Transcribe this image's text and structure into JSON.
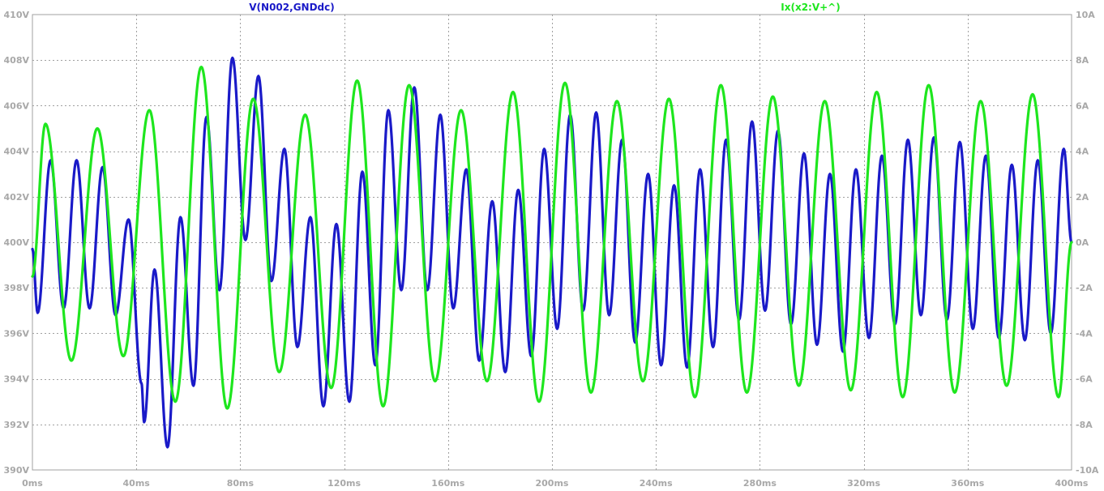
{
  "chart_data": {
    "type": "line",
    "title": "",
    "background": "#ffffff",
    "grid": true,
    "grid_color": "#a0a0a0",
    "x_axis": {
      "range": [
        0,
        400
      ],
      "unit": "ms",
      "ticks": [
        "0ms",
        "40ms",
        "80ms",
        "120ms",
        "160ms",
        "200ms",
        "240ms",
        "280ms",
        "320ms",
        "360ms",
        "400ms"
      ],
      "tick_values": [
        0,
        40,
        80,
        120,
        160,
        200,
        240,
        280,
        320,
        360,
        400
      ]
    },
    "y_left": {
      "range": [
        390,
        410
      ],
      "unit": "V",
      "ticks": [
        "390V",
        "392V",
        "394V",
        "396V",
        "398V",
        "400V",
        "402V",
        "404V",
        "406V",
        "408V",
        "410V"
      ],
      "tick_values": [
        390,
        392,
        394,
        396,
        398,
        400,
        402,
        404,
        406,
        408,
        410
      ]
    },
    "y_right": {
      "range": [
        -10,
        10
      ],
      "unit": "A",
      "ticks": [
        "-10A",
        "-8A",
        "-6A",
        "-4A",
        "-2A",
        "0A",
        "2A",
        "4A",
        "6A",
        "8A",
        "10A"
      ],
      "tick_values": [
        -10,
        -8,
        -6,
        -4,
        -2,
        0,
        2,
        4,
        6,
        8,
        10
      ]
    },
    "series": [
      {
        "name": "V(N002,GNDdc)",
        "axis": "left",
        "color": "#1a1ac8",
        "freq_hz": 100,
        "points": [
          [
            0,
            399.7
          ],
          [
            2,
            396.9
          ],
          [
            7,
            403.6
          ],
          [
            12,
            397.1
          ],
          [
            17,
            403.6
          ],
          [
            22,
            397.1
          ],
          [
            27,
            403.3
          ],
          [
            32,
            396.8
          ],
          [
            37,
            401.0
          ],
          [
            42,
            393.8
          ],
          [
            43,
            392.1
          ],
          [
            47,
            398.8
          ],
          [
            52,
            391.0
          ],
          [
            57,
            401.1
          ],
          [
            62,
            393.7
          ],
          [
            67,
            405.5
          ],
          [
            72,
            397.9
          ],
          [
            77,
            408.1
          ],
          [
            82,
            400.1
          ],
          [
            87,
            407.3
          ],
          [
            92,
            398.3
          ],
          [
            97,
            404.1
          ],
          [
            102,
            395.4
          ],
          [
            107,
            401.1
          ],
          [
            112,
            392.8
          ],
          [
            117,
            400.8
          ],
          [
            122,
            393.0
          ],
          [
            127,
            403.1
          ],
          [
            132,
            394.6
          ],
          [
            137,
            405.8
          ],
          [
            142,
            397.9
          ],
          [
            147,
            406.8
          ],
          [
            152,
            397.9
          ],
          [
            157,
            405.6
          ],
          [
            162,
            397.1
          ],
          [
            167,
            403.2
          ],
          [
            172,
            394.8
          ],
          [
            177,
            401.8
          ],
          [
            182,
            394.3
          ],
          [
            187,
            402.3
          ],
          [
            192,
            395.0
          ],
          [
            197,
            404.1
          ],
          [
            202,
            396.2
          ],
          [
            207,
            405.6
          ],
          [
            212,
            397.0
          ],
          [
            217,
            405.7
          ],
          [
            222,
            396.8
          ],
          [
            227,
            404.5
          ],
          [
            232,
            395.6
          ],
          [
            237,
            403.0
          ],
          [
            242,
            394.6
          ],
          [
            247,
            402.5
          ],
          [
            252,
            394.5
          ],
          [
            257,
            403.2
          ],
          [
            262,
            395.4
          ],
          [
            267,
            404.5
          ],
          [
            272,
            396.6
          ],
          [
            277,
            405.3
          ],
          [
            282,
            397.0
          ],
          [
            287,
            404.9
          ],
          [
            292,
            396.4
          ],
          [
            297,
            403.9
          ],
          [
            302,
            395.5
          ],
          [
            307,
            403.0
          ],
          [
            312,
            395.2
          ],
          [
            317,
            403.2
          ],
          [
            322,
            395.8
          ],
          [
            327,
            403.8
          ],
          [
            332,
            396.4
          ],
          [
            337,
            404.5
          ],
          [
            342,
            396.8
          ],
          [
            347,
            404.6
          ],
          [
            352,
            396.6
          ],
          [
            357,
            404.4
          ],
          [
            362,
            396.2
          ],
          [
            367,
            403.8
          ],
          [
            372,
            395.8
          ],
          [
            377,
            403.4
          ],
          [
            382,
            395.7
          ],
          [
            387,
            403.6
          ],
          [
            392,
            396.0
          ],
          [
            397,
            404.1
          ],
          [
            400,
            400.0
          ]
        ]
      },
      {
        "name": "Ix(x2:V+^)",
        "axis": "right",
        "color": "#1ee61e",
        "freq_hz": 50,
        "points": [
          [
            0,
            -1.5
          ],
          [
            5,
            5.2
          ],
          [
            15,
            -5.2
          ],
          [
            25,
            5.0
          ],
          [
            35,
            -5.0
          ],
          [
            45,
            5.8
          ],
          [
            55,
            -7.0
          ],
          [
            65,
            7.7
          ],
          [
            75,
            -7.3
          ],
          [
            85,
            6.3
          ],
          [
            95,
            -5.7
          ],
          [
            105,
            5.6
          ],
          [
            115,
            -6.4
          ],
          [
            125,
            7.1
          ],
          [
            135,
            -7.2
          ],
          [
            145,
            6.9
          ],
          [
            155,
            -6.1
          ],
          [
            165,
            5.8
          ],
          [
            175,
            -6.1
          ],
          [
            185,
            6.6
          ],
          [
            195,
            -7.0
          ],
          [
            205,
            7.0
          ],
          [
            215,
            -6.6
          ],
          [
            225,
            6.2
          ],
          [
            235,
            -6.1
          ],
          [
            245,
            6.3
          ],
          [
            255,
            -6.8
          ],
          [
            265,
            6.9
          ],
          [
            275,
            -6.6
          ],
          [
            285,
            6.4
          ],
          [
            295,
            -6.3
          ],
          [
            305,
            6.2
          ],
          [
            315,
            -6.5
          ],
          [
            325,
            6.6
          ],
          [
            335,
            -6.8
          ],
          [
            345,
            6.9
          ],
          [
            355,
            -6.6
          ],
          [
            365,
            6.2
          ],
          [
            375,
            -6.3
          ],
          [
            385,
            6.5
          ],
          [
            395,
            -6.8
          ],
          [
            400,
            0.0
          ]
        ]
      }
    ]
  }
}
